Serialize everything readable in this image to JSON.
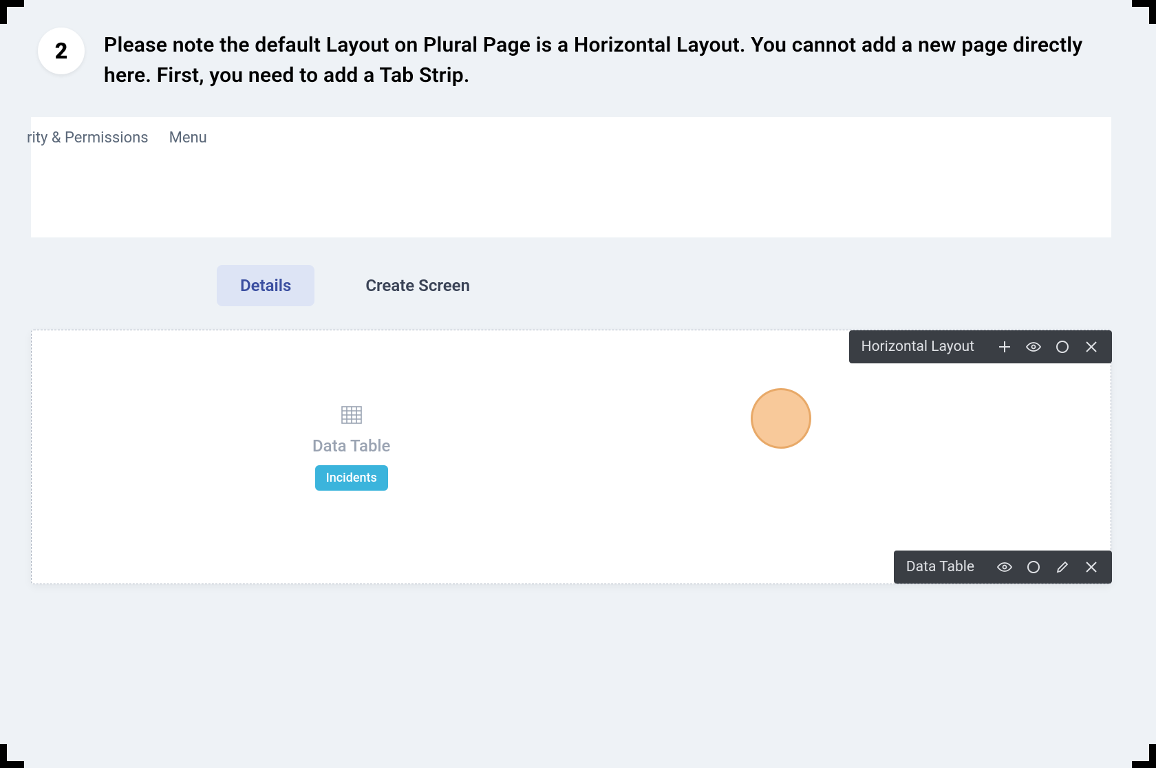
{
  "step": {
    "number": "2",
    "text": "Please note the default Layout on Plural Page is a Horizontal Layout. You cannot add a new page directly here. First, you need to add a Tab Strip."
  },
  "top_tabs": {
    "partial": "rity & Permissions",
    "menu": "Menu"
  },
  "subtabs": {
    "details": "Details",
    "create_screen": "Create Screen"
  },
  "toolbars": {
    "layout_label": "Horizontal Layout",
    "table_label": "Data Table"
  },
  "data_block": {
    "title": "Data Table",
    "chip": "Incidents"
  }
}
